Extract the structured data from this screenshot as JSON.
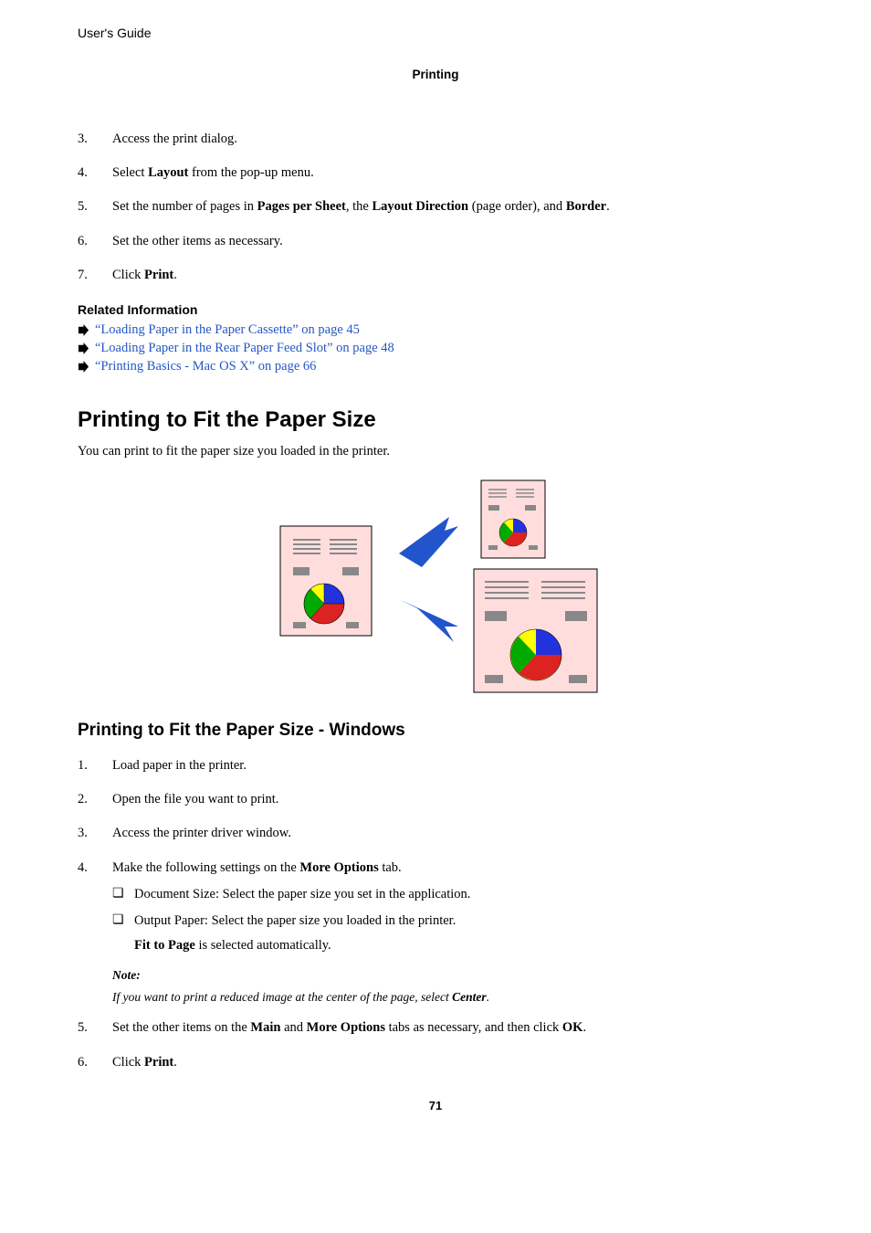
{
  "header": {
    "doc_title": "User's Guide",
    "section_header": "Printing"
  },
  "steps1": [
    {
      "n": "3.",
      "text": "Access the print dialog."
    },
    {
      "n": "4.",
      "text_pre": "Select ",
      "b1": "Layout",
      "text_post": " from the pop-up menu."
    },
    {
      "n": "5.",
      "text_pre": "Set the number of pages in ",
      "b1": "Pages per Sheet",
      "mid1": ", the ",
      "b2": "Layout Direction",
      "mid2": " (page order), and ",
      "b3": "Border",
      "text_post": "."
    },
    {
      "n": "6.",
      "text": "Set the other items as necessary."
    },
    {
      "n": "7.",
      "text_pre": "Click ",
      "b1": "Print",
      "text_post": "."
    }
  ],
  "related": {
    "heading": "Related Information",
    "items": [
      "“Loading Paper in the Paper Cassette” on page 45",
      "“Loading Paper in the Rear Paper Feed Slot” on page 48",
      "“Printing Basics - Mac OS X” on page 66"
    ]
  },
  "h2": "Printing to Fit the Paper Size",
  "intro": "You can print to fit the paper size you loaded in the printer.",
  "h3": "Printing to Fit the Paper Size - Windows",
  "steps2": [
    {
      "n": "1.",
      "text": "Load paper in the printer."
    },
    {
      "n": "2.",
      "text": "Open the file you want to print."
    },
    {
      "n": "3.",
      "text": "Access the printer driver window."
    },
    {
      "n": "4.",
      "text_pre": "Make the following settings on the ",
      "b1": "More Options",
      "text_post": " tab.",
      "subs": [
        "Document Size: Select the paper size you set in the application.",
        "Output Paper: Select the paper size you loaded in the printer."
      ],
      "sub_indent_b": "Fit to Page",
      "sub_indent_t": " is selected automatically.",
      "note_label": "Note:",
      "note_pre": "If you want to print a reduced image at the center of the page, select ",
      "note_b": "Center",
      "note_post": "."
    },
    {
      "n": "5.",
      "text_pre": "Set the other items on the ",
      "b1": "Main",
      "mid1": " and ",
      "b2": "More Options",
      "mid2": " tabs as necessary, and then click ",
      "b3": "OK",
      "text_post": "."
    },
    {
      "n": "6.",
      "text_pre": "Click ",
      "b1": "Print",
      "text_post": "."
    }
  ],
  "page_number": "71"
}
